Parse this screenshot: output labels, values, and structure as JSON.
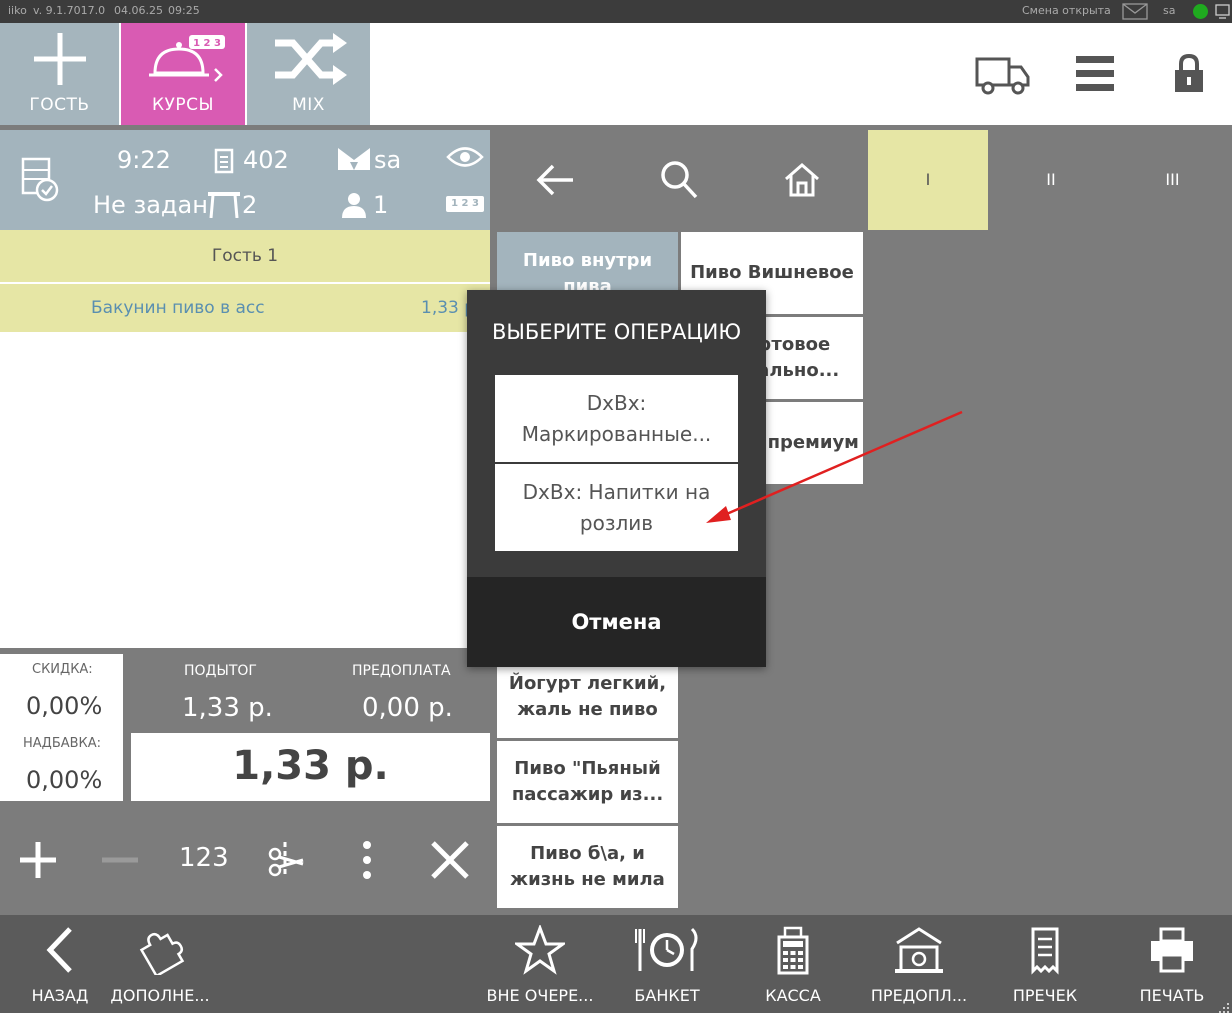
{
  "statusbar": {
    "app": "iiko",
    "version": "v. 9.1.7017.0",
    "date": "04.06.25",
    "time": "09:25",
    "shift": "Смена открыта",
    "user": "sa"
  },
  "header": {
    "guest_label": "ГОСТЬ",
    "courses_label": "КУРСЫ",
    "courses_badge": "1 2 3",
    "mix_label": "MIX"
  },
  "order_info": {
    "time": "9:22",
    "number": "402",
    "waiter": "sa",
    "client": "Не задан",
    "table": "2",
    "guests": "1",
    "eye_badge": "1 2 3"
  },
  "order": {
    "guest_title": "Гость 1",
    "items": [
      {
        "name": "Бакунин пиво в асс",
        "price": "1,33 р."
      }
    ]
  },
  "totals": {
    "discount_label": "СКИДКА:",
    "discount_value": "0,00%",
    "surcharge_label": "НАДБАВКА:",
    "surcharge_value": "0,00%",
    "subtotal_label": "ПОДЫТОГ",
    "subtotal_value": "1,33 р.",
    "prepay_label": "ПРЕДОПЛАТА",
    "prepay_value": "0,00 р.",
    "total_value": "1,33 р."
  },
  "actions": {
    "quantity_label": "123"
  },
  "nav": {
    "pages": [
      "I",
      "II",
      "III"
    ],
    "active_page": 0
  },
  "products": [
    "Пиво внутри пива",
    "Пиво Вишневое",
    "Крафтовое нормально...",
    "Темное премиум",
    "Йогурт легкий, жаль не пиво",
    "Пиво \"Пьяный пассажир из...",
    "Пиво б\\а, и жизнь не мила"
  ],
  "modal": {
    "title": "ВЫБЕРИТЕ ОПЕРАЦИЮ",
    "options": [
      "DxBx: Маркированные...",
      "DxBx: Напитки на розлив"
    ],
    "cancel": "Отмена"
  },
  "bottombar": {
    "back": "НАЗАД",
    "extra": "ДОПОЛНЕ...",
    "out_of_queue": "ВНЕ ОЧЕРЕ...",
    "banquet": "БАНКЕТ",
    "cashier": "КАССА",
    "prepay": "ПРЕДОПЛ...",
    "precheck": "ПРЕЧЕК",
    "print": "ПЕЧАТЬ"
  },
  "colors": {
    "courses_accent": "#d95bb3",
    "header_tile": "#a5b5bd",
    "info_panel": "#a3b4bd",
    "highlight_row": "#e6e6a5",
    "arrow": "#e02020"
  }
}
